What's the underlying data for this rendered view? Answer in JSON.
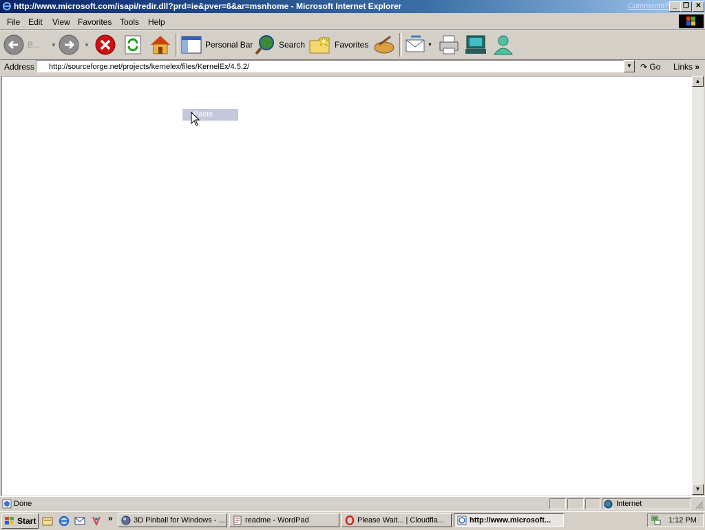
{
  "window": {
    "title": "http://www.microsoft.com/isapi/redir.dll?prd=ie&pver=6&ar=msnhome - Microsoft Internet Explorer",
    "comments_link": "Comments?"
  },
  "menu": {
    "items": [
      {
        "label": "File"
      },
      {
        "label": "Edit"
      },
      {
        "label": "View"
      },
      {
        "label": "Favorites"
      },
      {
        "label": "Tools"
      },
      {
        "label": "Help"
      }
    ]
  },
  "toolbar": {
    "back_label": "B...",
    "personal_bar_label": "Personal Bar",
    "search_label": "Search",
    "favorites_label": "Favorites"
  },
  "address": {
    "label": "Address",
    "value": "http://sourceforge.net/projects/kernelex/files/KernelEx/4.5.2/",
    "go_label": "Go",
    "links_label": "Links"
  },
  "context_menu": {
    "item": "Paste"
  },
  "status": {
    "text": "Done",
    "zone": "Internet"
  },
  "taskbar": {
    "start_label": "Start",
    "tasks": [
      {
        "label": "3D Pinball for Windows - ..."
      },
      {
        "label": "readme - WordPad"
      },
      {
        "label": "Please Wait... | Cloudfla..."
      },
      {
        "label": "http://www.microsoft..."
      }
    ],
    "clock": "1:12 PM"
  },
  "colors": {
    "title_gradient_start": "#0a246a",
    "title_gradient_end": "#a6caf0",
    "face": "#d4d0c8",
    "stop_red": "#cc1010",
    "context_highlight": "#c4c8dc"
  },
  "icons": [
    "ie-icon",
    "back-icon",
    "forward-icon",
    "stop-icon",
    "refresh-icon",
    "home-icon",
    "personal-bar-icon",
    "search-icon",
    "favorites-icon",
    "history-icon",
    "mail-icon",
    "print-icon",
    "messenger-icon",
    "windows-logo-icon"
  ]
}
